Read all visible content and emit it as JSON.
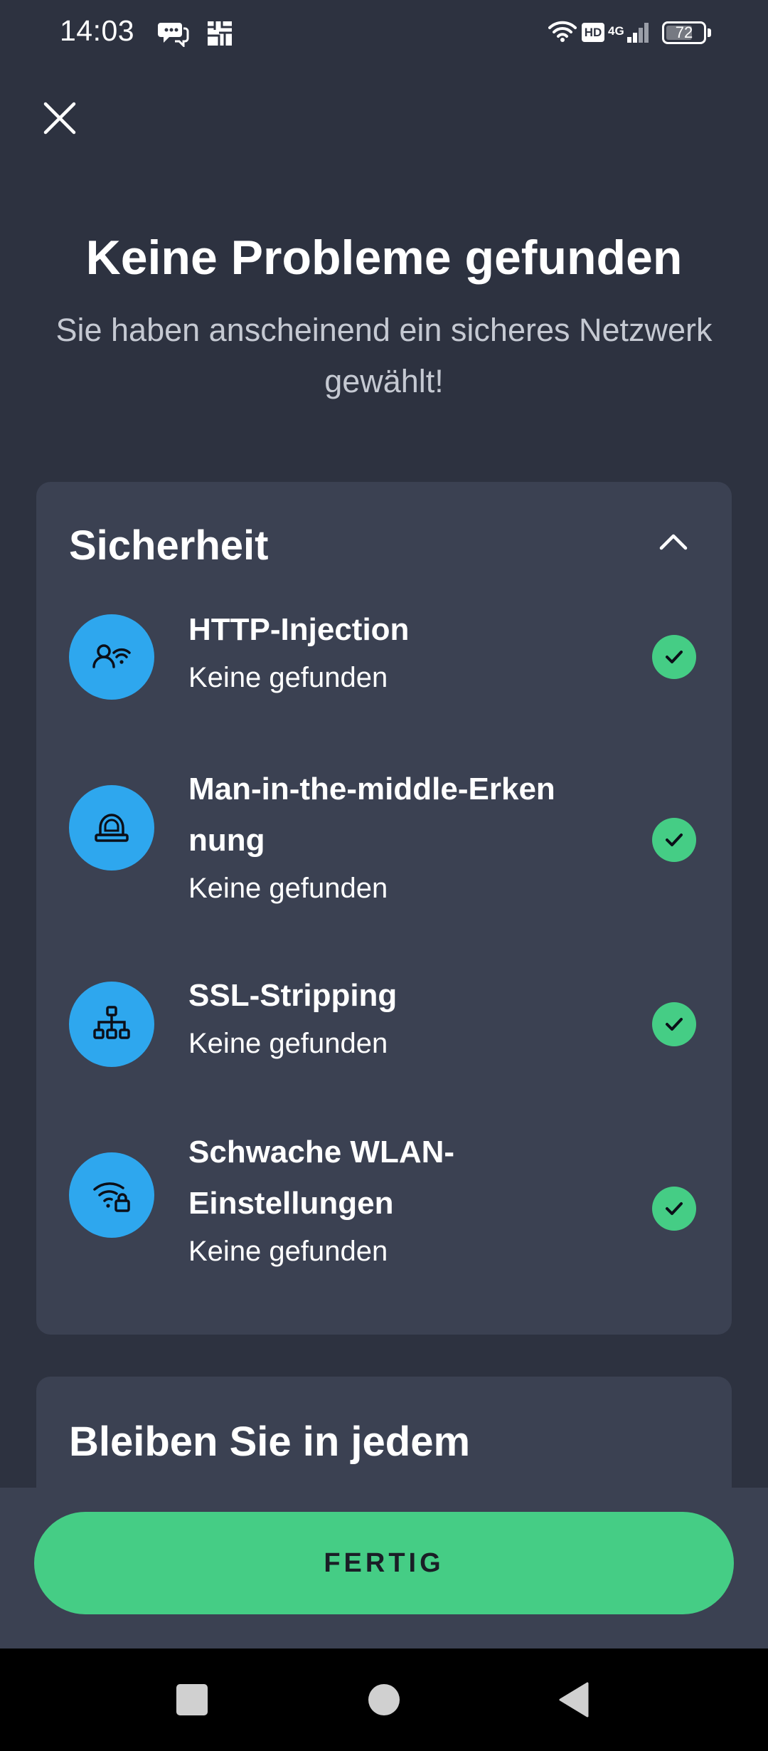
{
  "status_bar": {
    "time": "14:03",
    "network": "4G",
    "hd": "HD",
    "battery_percent": 72,
    "battery_label": "72",
    "icons": [
      "chat-icon",
      "puzzle-icon",
      "wifi-icon",
      "signal-icon",
      "battery-icon"
    ]
  },
  "header": {
    "close_icon": "close-icon",
    "title": "Keine Probleme gefunden",
    "subtitle": "Sie haben anscheinend ein sicheres Netzwerk gewählt!"
  },
  "security": {
    "title": "Sicherheit",
    "toggle_icon": "chevron-up-icon",
    "items": [
      {
        "icon": "person-wifi-icon",
        "title": "HTTP-Injection",
        "status": "Keine gefunden",
        "status_icon": "check-icon"
      },
      {
        "icon": "hacker-icon",
        "title": "Man-in-the-middle-Erken nung",
        "status": "Keine gefunden",
        "status_icon": "check-icon"
      },
      {
        "icon": "network-tree-icon",
        "title": "SSL-Stripping",
        "status": "Keine gefunden",
        "status_icon": "check-icon"
      },
      {
        "icon": "wifi-lock-icon",
        "title": "Schwache WLAN-Einstellungen",
        "status": "Keine gefunden",
        "status_icon": "check-icon"
      }
    ]
  },
  "stay_card": {
    "title": "Bleiben Sie in jedem"
  },
  "footer": {
    "done_label": "FERTIG"
  },
  "colors": {
    "background": "#2d3240",
    "card": "#3b4152",
    "accent_blue": "#2ea7ee",
    "accent_green": "#45cd85"
  }
}
